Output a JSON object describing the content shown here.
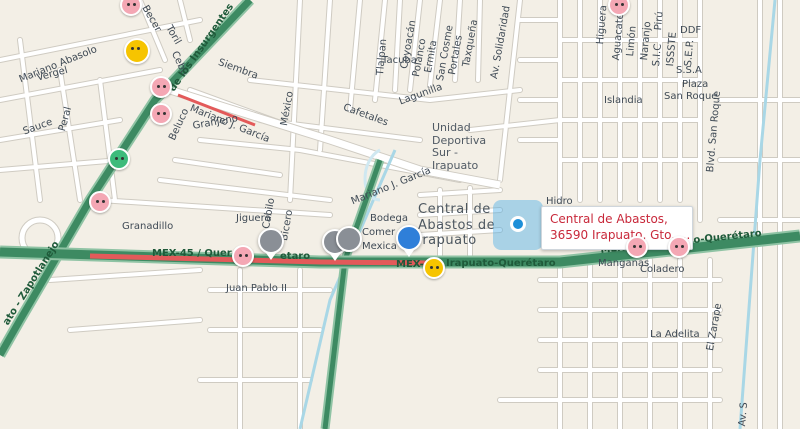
{
  "map": {
    "place_callout": {
      "line1": "Central de Abastos,",
      "line2": "36590 Irapuato, Gto.,..."
    },
    "colors": {
      "background": "#f3efe6",
      "road": "#ffffff",
      "road_outline": "#cfcbc2",
      "highway": "#3d8a62",
      "highway_edge": "#8fc3a4",
      "traffic_jam": "#e35a5a",
      "location": "#1d8fd8",
      "railway": "#bfe3ee"
    },
    "labels": {
      "becerra": "Becer",
      "toril": "Toril",
      "cebu": "Cebú",
      "mariano_abasolo": "Mariano Abasolo",
      "vergel": "Vergel",
      "insurgentes": "de los Insurgentes",
      "siembra": "Siembra",
      "sauce": "Sauce",
      "peral": "Peral",
      "beluco": "Beluco",
      "mariano_garcia_1": "Mariano J. García",
      "granjeno": "Granjeno",
      "mexico": "México",
      "tlalpan": "Tlalpan",
      "coyoacan": "Coyoacán",
      "tacuba": "Tacuba",
      "polanco": "Polanco",
      "ermita": "Ermita",
      "san_cosme": "San Cosme",
      "portales": "Portales",
      "taxquena": "Taxqueña",
      "av_solidaridad": "Av. Solidaridad",
      "lagunilla": "Lagunilla",
      "cafetales": "Cafetales",
      "unidad_deportiva": "Unidad Deportiva Sur - Irapuato",
      "mariano_garcia_2": "Mariano J. García",
      "granadillo": "Granadillo",
      "jiguero": "Jiguero",
      "bodega": "Bodega",
      "comercial": "Comer",
      "mexica": "Mexica",
      "central_abastos": "Central de Abastos de Irapuato",
      "hidro": "Hidro",
      "higuera": "Higuera",
      "aguacate": "Aguacate",
      "limon": "Limón",
      "naranjo": "Naranjo",
      "piru": "Pirú",
      "sic": "S.I.C",
      "issste": "ISSSTE",
      "ddf": "DDF",
      "sep": "S.E.P.",
      "ssa": "S.S.A",
      "plaza": "Plaza",
      "san_roque": "San Roque",
      "islandia": "Islandia",
      "blvd_san_roque": "Blvd. San Roque",
      "mex45_west": "MEX-45 / Quer",
      "mex45_west_tail": "etaro",
      "mex45_center": "MEX-45",
      "irapuato_queretaro": "Irapuato-Querétaro",
      "mex45_east": "MEX-45 / Irapuato-Querétaro",
      "manganas": "Manganas",
      "coladero": "Coladero",
      "juan_pablo": "Juan Pablo II",
      "zapotlanejo": "ato - Zapotlanejo",
      "la_adelita": "La Adelita",
      "el_zarape": "El Zarape",
      "av_s": "Av. S",
      "cabilo": "Cabilo",
      "bicero": "Bicero"
    }
  }
}
